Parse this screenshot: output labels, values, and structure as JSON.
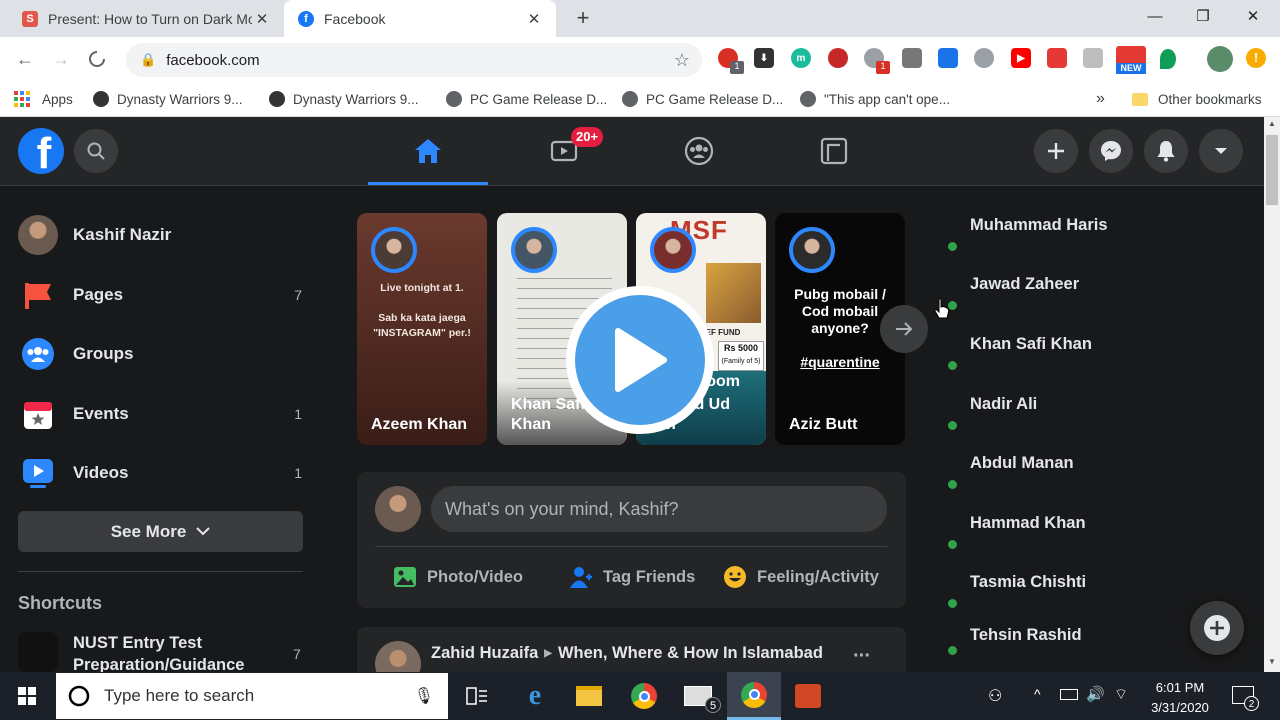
{
  "browser": {
    "tabs": [
      {
        "title": "Present: How to Turn on Dark Mode"
      },
      {
        "title": "Facebook"
      }
    ],
    "new_tab": "+",
    "url": "facebook.com",
    "bookmarks": [
      {
        "label": "Apps"
      },
      {
        "label": "Dynasty Warriors 9..."
      },
      {
        "label": "Dynasty Warriors 9..."
      },
      {
        "label": "PC Game Release D..."
      },
      {
        "label": "PC Game Release D..."
      },
      {
        "label": "\"This app can't ope..."
      }
    ],
    "bookmarks_more": "»",
    "other_bookmarks": "Other bookmarks",
    "ext_badge1": "1",
    "ext_badge2": "1",
    "ext_new": "NEW"
  },
  "facebook": {
    "header": {
      "watch_badge": "20+"
    },
    "user": {
      "name": "Kashif Nazir"
    },
    "sidebar": {
      "items": [
        {
          "label": "Pages",
          "count": "7"
        },
        {
          "label": "Groups",
          "count": ""
        },
        {
          "label": "Events",
          "count": "1"
        },
        {
          "label": "Videos",
          "count": "1"
        }
      ],
      "see_more": "See More",
      "shortcuts_title": "Shortcuts",
      "shortcut": {
        "label": "NUST Entry Test Preparation/Guidance",
        "count": "7"
      }
    },
    "stories": [
      {
        "name": "Azeem Khan",
        "text": "Live tonight at 1.\n\nSab ka kata jaega \"INSTAGRAM\" per.!"
      },
      {
        "name": "Khan Safi Khan"
      },
      {
        "name": "Ahmad Ud Din",
        "banner": "MSF",
        "relief": "CORONA RELIEF FUND",
        "amount": "Rs 5000",
        "family": "(Family of 5)",
        "room": "room"
      },
      {
        "name": "Aziz Butt",
        "text": "Pubg mobail / Cod mobail anyone?",
        "tag": "#quarentine"
      }
    ],
    "composer": {
      "placeholder": "What's on your mind, Kashif?",
      "actions": [
        {
          "label": "Photo/Video"
        },
        {
          "label": "Tag Friends"
        },
        {
          "label": "Feeling/Activity"
        }
      ]
    },
    "post": {
      "author": "Zahid Huzaifa",
      "target": "When, Where & How In Islamabad",
      "more": "···"
    },
    "contacts": [
      {
        "name": "Muhammad Haris"
      },
      {
        "name": "Jawad Zaheer"
      },
      {
        "name": "Khan Safi Khan"
      },
      {
        "name": "Nadir Ali"
      },
      {
        "name": "Abdul Manan"
      },
      {
        "name": "Hammad Khan"
      },
      {
        "name": "Tasmia Chishti"
      },
      {
        "name": "Tehsin Rashid"
      }
    ]
  },
  "taskbar": {
    "search_placeholder": "Type here to search",
    "mail_badge": "5",
    "time": "6:01 PM",
    "date": "3/31/2020",
    "notif_count": "2"
  }
}
